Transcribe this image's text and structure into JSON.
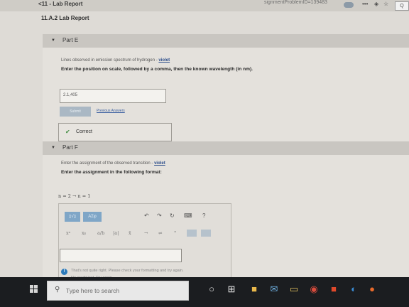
{
  "browser": {
    "back_link": "<11 - Lab Report",
    "url_fragment": "signmentProblemID=139483",
    "icons": [
      "more-icon",
      "pocket-icon",
      "star-icon",
      "search-icon"
    ]
  },
  "page": {
    "title": "11.A.2 Lab Report"
  },
  "partE": {
    "header": "Part E",
    "prompt_prefix": "Lines observed in emission spectrum of hydrogen - ",
    "prompt_color": "violet",
    "instruction": "Enter the position on scale, followed by a comma, then the known wavelength (in nm).",
    "answer_value": "2.1,405",
    "submit_label": "Submit",
    "previous_answers_label": "Previous Answers",
    "status_label": "Correct",
    "status_color": "#3d8b3d"
  },
  "partF": {
    "header": "Part F",
    "prompt_prefix": "Enter the assignment of the observed transition - ",
    "prompt_color": "violet",
    "instruction": "Enter the assignment in the following format:",
    "format_expression": "n = 2 → n = 1",
    "toolbar": {
      "template_button": "▯√▯",
      "greek_button": "ΑΣφ",
      "undo": "↶",
      "redo": "↷",
      "reset": "↻",
      "keyboard": "⌨",
      "help": "?"
    },
    "symbols_row": [
      "xᵃ",
      "xᵦ",
      "a/b",
      "|a|",
      "x̄",
      "→",
      "⇌",
      "°"
    ],
    "math_input_value": "",
    "feedback_line1": "That's not quite right. Please check your formatting and try again.",
    "feedback_line2": "No credit lost. Try again."
  },
  "taskbar": {
    "search_placeholder": "Type here to search",
    "apps": [
      "cortana-icon",
      "task-view-icon",
      "store-icon",
      "mail-icon",
      "file-explorer-icon",
      "chrome-icon",
      "office-icon",
      "edge-icon",
      "firefox-icon"
    ]
  },
  "colors": {
    "link": "#2b4c8a",
    "accent_button": "#7fa6c7",
    "taskbar": "#1b1d20"
  }
}
